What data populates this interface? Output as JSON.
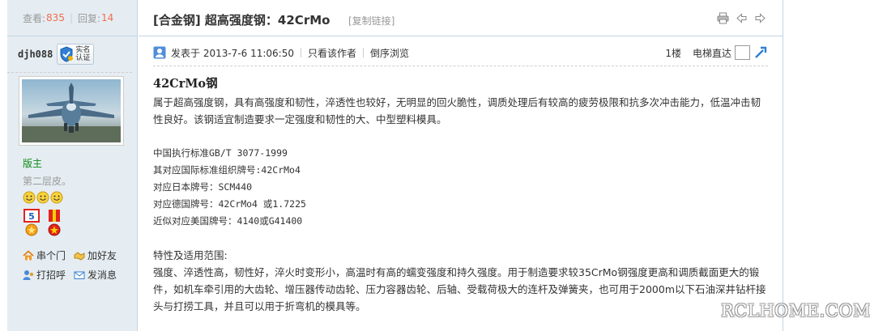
{
  "stats": {
    "views_label": "查看:",
    "views": "835",
    "replies_label": "回复:",
    "replies": "14"
  },
  "author": {
    "name": "djh088",
    "badge_line1": "实名",
    "badge_line2": "认证"
  },
  "user": {
    "role": "版主",
    "signature": "第二层皮。"
  },
  "user_links": {
    "visit": "串个门",
    "add_friend": "加好友",
    "greet": "打招呼",
    "message": "发消息"
  },
  "thread": {
    "title": "[合金钢] 超高强度钢：42CrMo",
    "copy_link": "[复制链接]"
  },
  "post_bar": {
    "posted_at": "发表于 2013-7-6 11:06:50",
    "only_author": "只看该作者",
    "reverse": "倒序浏览",
    "floor": "1楼",
    "jump": "电梯直达"
  },
  "post": {
    "heading": "42CrMo钢",
    "intro": "属于超高强度钢，具有高强度和韧性，淬透性也较好，无明显的回火脆性，调质处理后有较高的疲劳极限和抗多次冲击能力，低温冲击韧性良好。该钢适宜制造要求一定强度和韧性的大、中型塑料模具。",
    "std_cn": "中国执行标准GB/T 3077-1999",
    "std_intl": "其对应国际标准组织牌号:42CrMo4",
    "std_jp": "对应日本牌号：SCM440",
    "std_de": "对应德国牌号：42CrMo4 或1.7225",
    "std_us": "近似对应美国牌号：4140或G41400",
    "features_title": "特性及适用范围:",
    "features": "强度、淬透性高，韧性好，淬火时变形小，高温时有高的蠕变强度和持久强度。用于制造要求较35CrMo钢强度更高和调质截面更大的锻件，如机车牵引用的大齿轮、增压器传动齿轮、压力容器齿轮、后轴、受载荷极大的连杆及弹簧夹，也可用于2000m以下石油深井钻杆接头与打捞工具，并且可以用于折弯机的模具等。"
  },
  "watermark": "RCLHOME.COM",
  "colors": {
    "accent_orange": "#f26c4f",
    "role_green": "#0b8a14",
    "border_blue": "#c2d5e3",
    "sidebar_bg": "#e5edf2"
  },
  "icons": [
    "print-icon",
    "prev-icon",
    "next-icon",
    "post-icon",
    "jump-icon",
    "home-icon",
    "handshake-icon",
    "greet-icon",
    "mail-icon",
    "shield-icon",
    "smiley-icon",
    "medal-icon"
  ]
}
